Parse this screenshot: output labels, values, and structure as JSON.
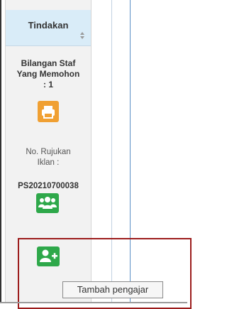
{
  "column": {
    "header_title": "Tindakan",
    "staff_label_line1": "Bilangan Staf",
    "staff_label_line2": "Yang Memohon",
    "staff_label_line3": ": 1",
    "ref_label_line1": "No. Rujukan",
    "ref_label_line2": "Iklan :",
    "ref_number": "PS20210700038"
  },
  "buttons": {
    "print_icon": "printer-icon",
    "group_icon": "users-group-icon",
    "add_icon": "add-user-icon"
  },
  "tooltip": {
    "text": "Tambah pengajar"
  },
  "colors": {
    "header_bg": "#d9ecf8",
    "print_button": "#f0a033",
    "green_button": "#2ea84a",
    "highlight_box": "#9c1c1c"
  }
}
